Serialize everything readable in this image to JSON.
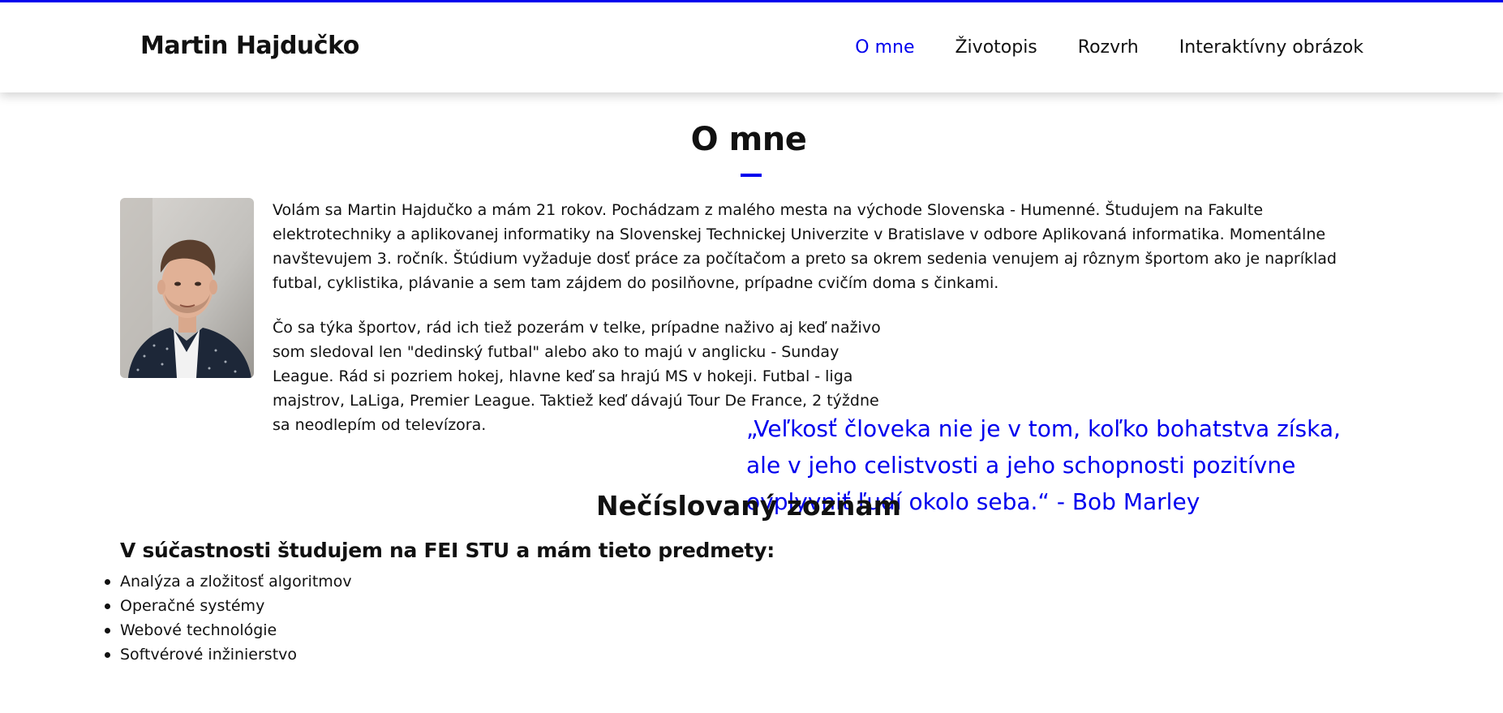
{
  "header": {
    "brand": "Martin Hajdučko",
    "nav": [
      {
        "label": "O mne",
        "active": true
      },
      {
        "label": "Životopis",
        "active": false
      },
      {
        "label": "Rozvrh",
        "active": false
      },
      {
        "label": "Interaktívny obrázok",
        "active": false
      }
    ]
  },
  "colors": {
    "accent": "#0000ee",
    "text": "#111111",
    "background": "#ffffff"
  },
  "main": {
    "title": "O mne",
    "about_paragraph_1": "Volám sa Martin Hajdučko a mám 21 rokov. Pochádzam z malého mesta na východe Slovenska - Humenné. Študujem na Fakulte elektrotechniky a aplikovanej informatiky na Slovenskej Technickej Univerzite v Bratislave v odbore Aplikovaná informatika. Momentálne navštevujem 3. ročník. Štúdium vyžaduje dosť práce za počítačom a preto sa okrem sedenia venujem aj rôznym športom ako je napríklad futbal, cyklistika, plávanie a sem tam zájdem do posilňovne, prípadne cvičím doma s činkami.",
    "about_paragraph_2": "Čo sa týka športov, rád ich tiež pozerám v telke, prípadne naživo aj keď naživo som sledoval len \"dedinský futbal\" alebo ako to majú v anglicku - Sunday League. Rád si pozriem hokej, hlavne keď sa hrajú MS v hokeji. Futbal - liga majstrov, LaLiga, Premier League. Taktiež keď dávajú Tour De France, 2 týždne sa neodlepím od televízora.",
    "quote": "„Veľkosť človeka nie je v tom, koľko bohatstva získa, ale v jeho celistvosti a jeho schopnosti pozitívne ovplyvniť ľudí okolo seba.“ - Bob Marley",
    "list_section_title": "Nečíslovaný zoznam",
    "list_heading": "V súčastnosti študujem na FEI STU a mám tieto predmety:",
    "subjects": [
      "Analýza a zložitosť algoritmov",
      "Operačné systémy",
      "Webové technológie",
      "Softvérové inžinierstvo"
    ]
  }
}
